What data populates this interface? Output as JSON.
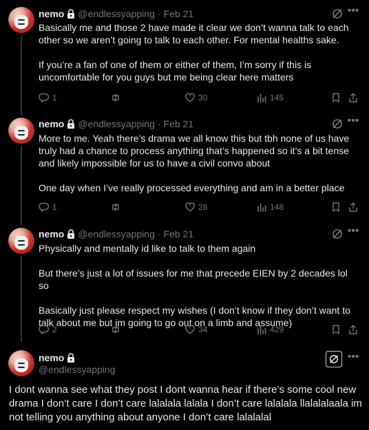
{
  "tweets": [
    {
      "name": "nemo",
      "handle": "@endlessyapping",
      "dot": "·",
      "date": "Feb 21",
      "text": "Basically me and those 2 have made it clear we don’t wanna talk to each other so we aren’t going to talk to each other. For mental healths sake.\n\nIf you’re a fan of one of them or either of them, I’m sorry if this is uncomfortable for you guys but me being clear here matters",
      "replies": "1",
      "likes": "30",
      "views": "145"
    },
    {
      "name": "nemo",
      "handle": "@endlessyapping",
      "dot": "·",
      "date": "Feb 21",
      "text": "More to me. Yeah there’s drama we all know this but tbh none of us have truly had a chance to process anything that’s happened so it’s a bit tense and likely impossible for us to have a civil convo about\n\nOne day when I’ve really processed everything and am in a better place",
      "replies": "1",
      "likes": "28",
      "views": "148"
    },
    {
      "name": "nemo",
      "handle": "@endlessyapping",
      "dot": "·",
      "date": "Feb 21",
      "text": "Physically and mentally id like to talk to them again\n\nBut there’s just a lot of issues for me that precede EIEN by 2 decades lol so\n\nBasically just please respect my wishes (I don’t know if they don’t want to talk about me but im going to go out on a limb and assume)",
      "replies": "2",
      "likes": "34",
      "views": "429"
    }
  ],
  "main": {
    "name": "nemo",
    "handle": "@endlessyapping",
    "text": "I dont wanna see what they post I dont wanna hear if there’s some cool new drama I don’t care I don’t care lalalala lalala I don’t care lalalala llalalalaala im not telling you anything about anyone I don’t care lalalalal"
  },
  "icons": {
    "lock": "lock-icon",
    "grok": "grok-icon",
    "more": "more-icon",
    "reply": "reply-icon",
    "repost": "repost-icon",
    "like": "like-icon",
    "views": "views-icon",
    "bookmark": "bookmark-icon",
    "share": "share-icon"
  },
  "colors": {
    "background": "#000000",
    "text": "#e7e9ea",
    "muted": "#71767b",
    "divider": "#2f3336"
  }
}
